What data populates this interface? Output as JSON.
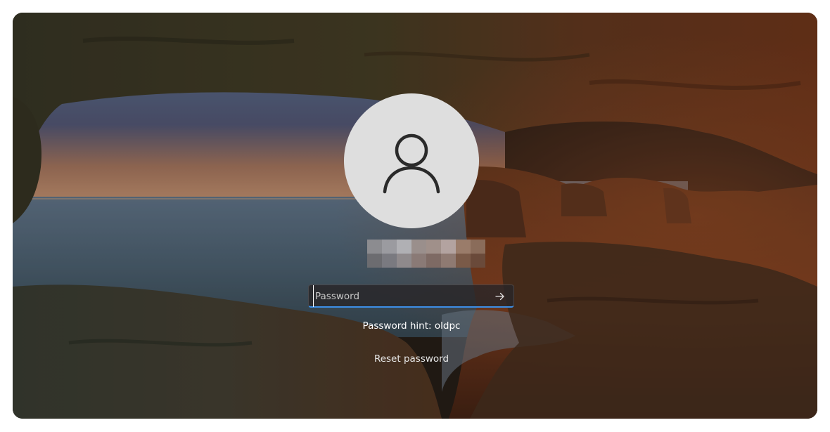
{
  "login": {
    "password_placeholder": "Password",
    "password_value": "",
    "hint_text": "Password hint: oldpc",
    "reset_label": "Reset password"
  },
  "icons": {
    "avatar": "user-silhouette-icon",
    "submit": "arrow-right-icon"
  },
  "colors": {
    "focus_underline": "#3d8ee6",
    "avatar_bg": "#dedede",
    "input_bg": "#282628"
  }
}
